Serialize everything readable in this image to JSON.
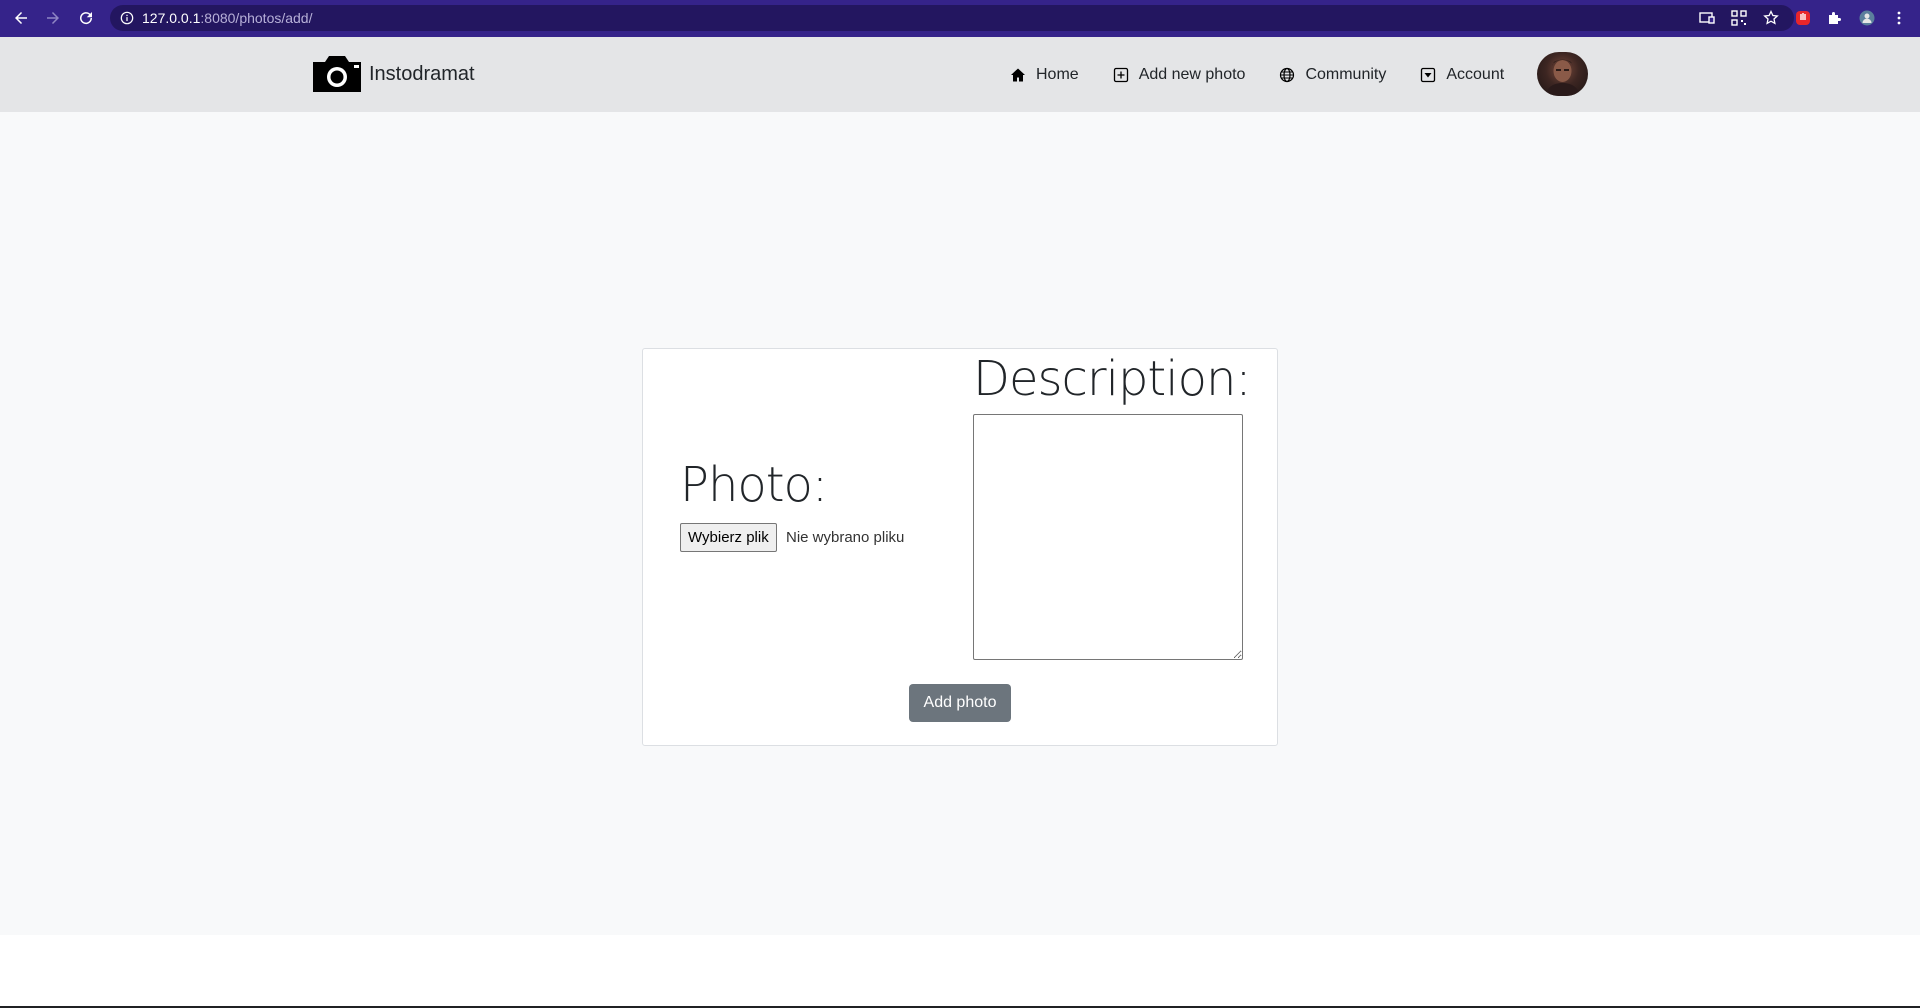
{
  "browser": {
    "url_host": "127.0.0.1",
    "url_path": ":8080/photos/add/",
    "accent_color": "#35238a"
  },
  "app": {
    "brand_name": "Instodramat"
  },
  "nav": {
    "home": "Home",
    "add_new_photo": "Add new photo",
    "community": "Community",
    "account": "Account"
  },
  "form": {
    "photo_label": "Photo:",
    "file_button": "Wybierz plik",
    "file_status": "Nie wybrano pliku",
    "description_label": "Description:",
    "description_value": "",
    "submit_label": "Add photo"
  },
  "colors": {
    "navbar_bg": "#e4e5e7",
    "page_bg": "#f8f9fa",
    "submit_bg": "#6c757d"
  }
}
